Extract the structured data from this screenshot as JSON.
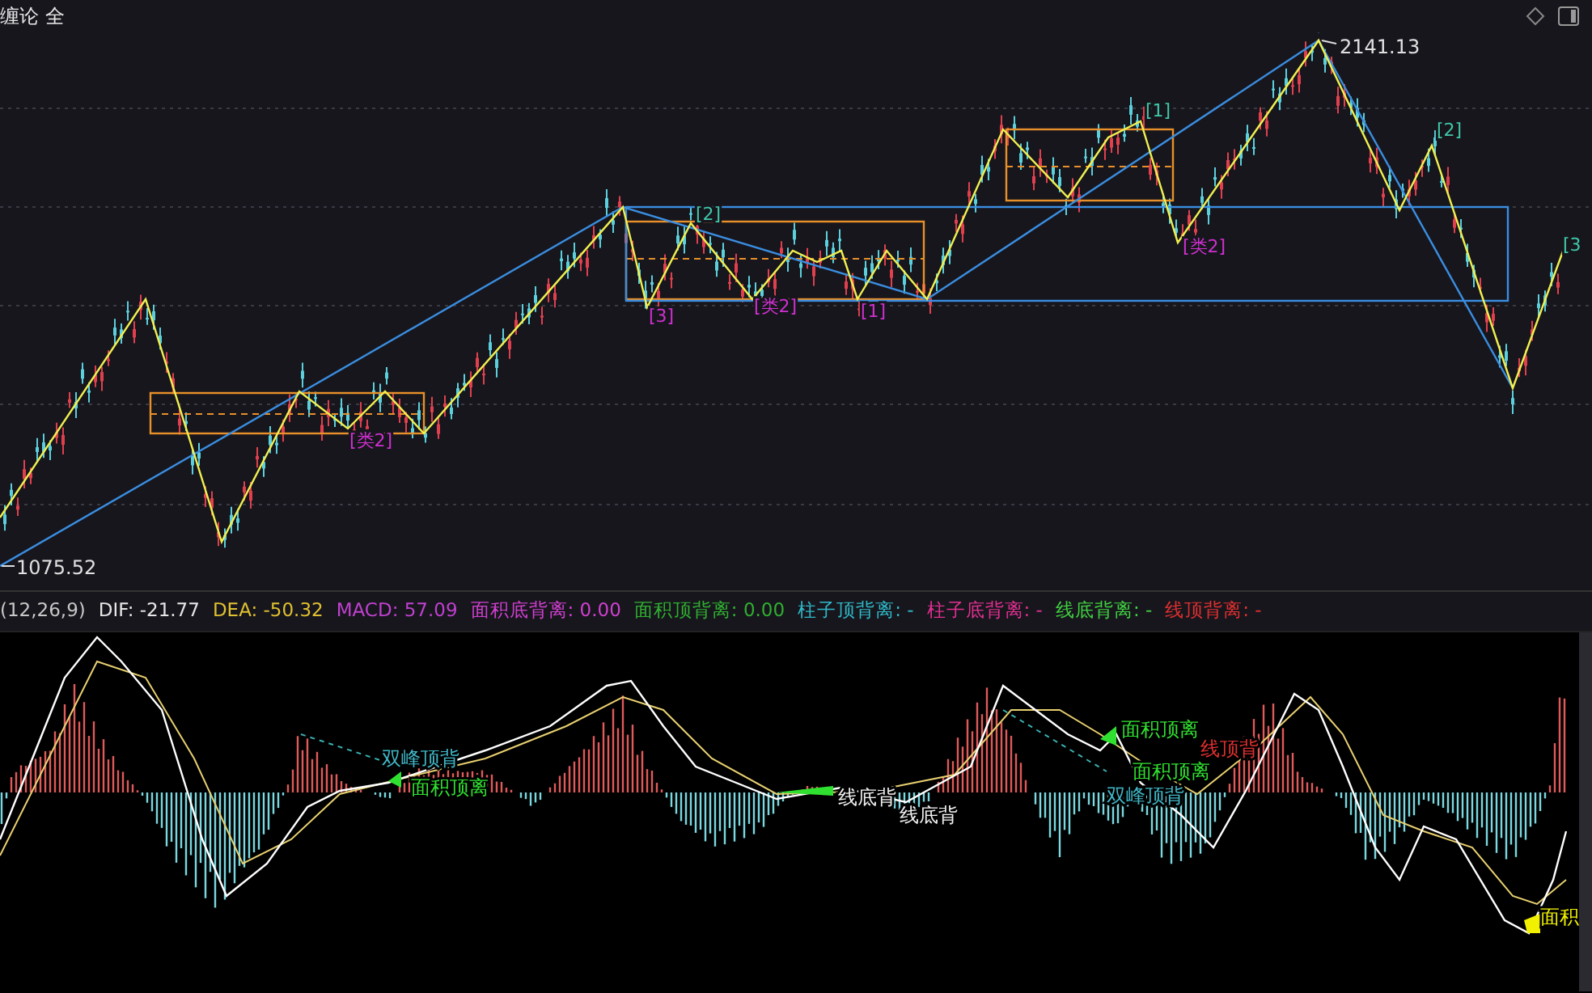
{
  "header": {
    "title": "缠论 全"
  },
  "price_chart": {
    "high_label": "2141.13",
    "low_label": "1075.52",
    "stroke_labels": [
      {
        "text": "[类2]",
        "color": "#d030d0"
      },
      {
        "text": "[3]",
        "color": "#d030d0"
      },
      {
        "text": "[2]",
        "color": "#40c8a8"
      },
      {
        "text": "[类2]",
        "color": "#d030d0"
      },
      {
        "text": "[1]",
        "color": "#d030d0"
      },
      {
        "text": "[1]",
        "color": "#40c8a8"
      },
      {
        "text": "[类2]",
        "color": "#d030d0"
      },
      {
        "text": "[2]",
        "color": "#40c8a8"
      },
      {
        "text": "[3",
        "color": "#40c8a8"
      }
    ]
  },
  "indicator_legend": [
    {
      "text": "(12,26,9)",
      "color": "#c8c8c8"
    },
    {
      "text": "DIF: -21.77",
      "color": "#e6e6e6"
    },
    {
      "text": "DEA: -50.32",
      "color": "#e0c030"
    },
    {
      "text": "MACD: 57.09",
      "color": "#c040d0"
    },
    {
      "text": "面积底背离: 0.00",
      "color": "#d040d0"
    },
    {
      "text": "面积顶背离: 0.00",
      "color": "#30b030"
    },
    {
      "text": "柱子顶背离: -",
      "color": "#30b8c8"
    },
    {
      "text": "柱子底背离: -",
      "color": "#e03090"
    },
    {
      "text": "线底背离: -",
      "color": "#40d040"
    },
    {
      "text": "线顶背离: -",
      "color": "#e03030"
    }
  ],
  "macd_chart": {
    "signal_labels": [
      {
        "text": "双峰顶背",
        "color": "#40b8c8"
      },
      {
        "text": "面积顶离",
        "color": "#30e030"
      },
      {
        "text": "线底背",
        "color": "#f0f0f0"
      },
      {
        "text": "线底背",
        "color": "#f0f0f0"
      },
      {
        "text": "面积顶离",
        "color": "#30e030"
      },
      {
        "text": "线顶背",
        "color": "#e03030"
      },
      {
        "text": "面积顶离",
        "color": "#30e030"
      },
      {
        "text": "双峰顶背",
        "color": "#40b8c8"
      },
      {
        "text": "面积",
        "color": "#f0f000"
      }
    ]
  }
}
